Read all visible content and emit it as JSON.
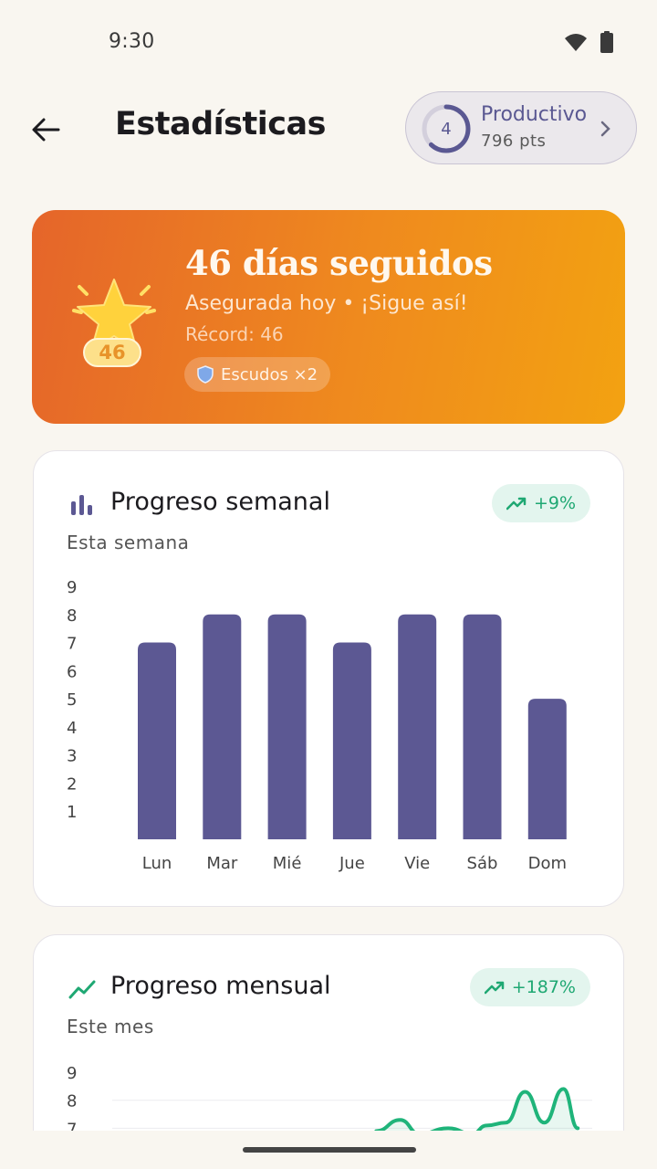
{
  "status": {
    "time": "9:30",
    "wifi_icon": "wifi-icon",
    "battery_icon": "battery-icon"
  },
  "header": {
    "back_icon": "arrow-back-icon",
    "title": "Estadísticas",
    "level": {
      "number": "4",
      "name": "Productivo",
      "points": "796 pts",
      "progress": 0.62
    }
  },
  "streak": {
    "title": "46 días seguidos",
    "subtitle": "Asegurada hoy • ¡Sigue así!",
    "record": "Récord: 46",
    "badge_count": "46",
    "shields": "Escudos ×2",
    "shield_icon": "shield-icon",
    "colors": {
      "start": "#e5652a",
      "end": "#f3a211"
    }
  },
  "weekly": {
    "title": "Progreso semanal",
    "subtitle": "Esta semana",
    "trend": "+9%",
    "icon": "bar-chart-icon"
  },
  "monthly": {
    "title": "Progreso mensual",
    "subtitle": "Este mes",
    "trend": "+187%",
    "icon": "trending-up-icon"
  },
  "chart_data": [
    {
      "type": "bar",
      "categories": [
        "Lun",
        "Mar",
        "Mié",
        "Jue",
        "Vie",
        "Sáb",
        "Dom"
      ],
      "values": [
        7,
        8,
        8,
        7,
        8,
        8,
        5
      ],
      "yticks": [
        "1",
        "2",
        "3",
        "4",
        "5",
        "6",
        "7",
        "8",
        "9"
      ],
      "ylim": [
        0,
        9
      ],
      "color": "#5c5893"
    },
    {
      "type": "line",
      "yticks_visible": [
        "9",
        "8",
        "7"
      ],
      "ylim": [
        0,
        9
      ],
      "color": "#1fb47a",
      "points": [
        [
          0.55,
          6.9
        ],
        [
          0.6,
          7.3
        ],
        [
          0.64,
          6.8
        ],
        [
          0.7,
          7.0
        ],
        [
          0.75,
          6.8
        ],
        [
          0.78,
          7.1
        ],
        [
          0.82,
          7.2
        ],
        [
          0.86,
          8.3
        ],
        [
          0.9,
          7.2
        ],
        [
          0.94,
          8.4
        ],
        [
          0.97,
          7.0
        ]
      ]
    }
  ]
}
